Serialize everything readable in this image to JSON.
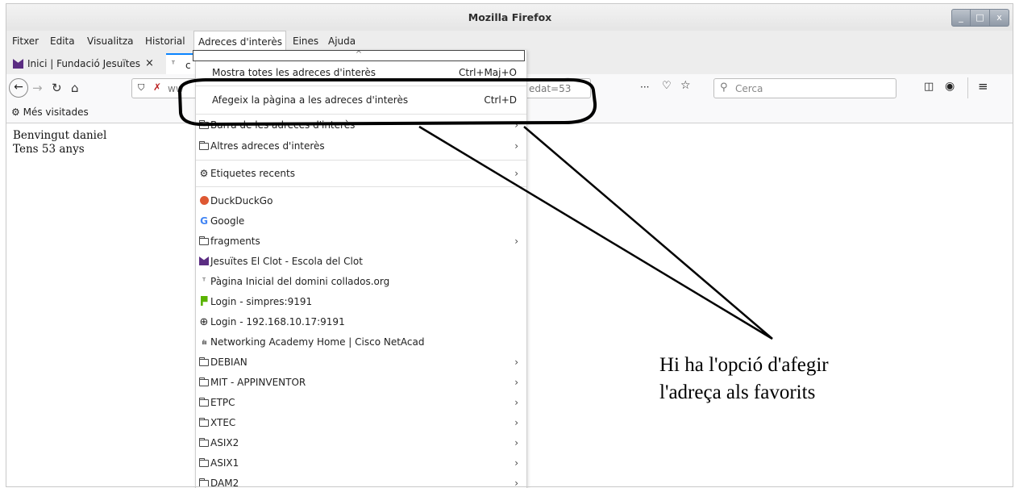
{
  "window": {
    "title": "Mozilla Firefox",
    "min": "_",
    "max": "□",
    "close": "x"
  },
  "menubar": {
    "items": [
      "Fitxer",
      "Edita",
      "Visualitza",
      "Historial",
      "Adreces d'interès",
      "Eines",
      "Ajuda"
    ]
  },
  "tabs": [
    {
      "label": "Inici | Fundació Jesuïtes",
      "close": "×"
    },
    {
      "label": "c"
    }
  ],
  "navbar": {
    "url_prefix": "ww",
    "url_suffix": "edat=53",
    "more": "···",
    "search_placeholder": "Cerca"
  },
  "bookmarks_toolbar": {
    "most_visited": "Més visitades"
  },
  "content": {
    "line1": "Benvingut daniel",
    "line2": "Tens 53 anys"
  },
  "bookmarks_menu": {
    "scroll_up": "^",
    "show_all": {
      "label": "Mostra totes les adreces d'interès",
      "shortcut": "Ctrl+Maj+O"
    },
    "add_page": {
      "label": "Afegeix la pàgina a les adreces d'interès",
      "shortcut": "Ctrl+D"
    },
    "toolbar_folder": "Barra de les adreces d'interès",
    "other_folder": "Altres adreces d'interès",
    "recent_tags": "Etiquetes recents",
    "entries": [
      {
        "label": "DuckDuckGo",
        "icon": "duckduckgo-icon",
        "submenu": false
      },
      {
        "label": "Google",
        "icon": "google-icon",
        "submenu": false
      },
      {
        "label": "fragments",
        "icon": "folder-icon",
        "submenu": true
      },
      {
        "label": "Jesuïtes El Clot - Escola del Clot",
        "icon": "jesuites-icon",
        "submenu": false
      },
      {
        "label": "Pàgina Inicial del domini collados.org",
        "icon": "collados-icon",
        "submenu": false
      },
      {
        "label": "Login - simpres:9191",
        "icon": "papercut-icon",
        "submenu": false
      },
      {
        "label": "Login - 192.168.10.17:9191",
        "icon": "globe-icon",
        "submenu": false
      },
      {
        "label": "Networking Academy Home | Cisco NetAcad",
        "icon": "cisco-icon",
        "submenu": false
      },
      {
        "label": "DEBIAN",
        "icon": "folder-icon",
        "submenu": true
      },
      {
        "label": "MIT - APPINVENTOR",
        "icon": "folder-icon",
        "submenu": true
      },
      {
        "label": "ETPC",
        "icon": "folder-icon",
        "submenu": true
      },
      {
        "label": "XTEC",
        "icon": "folder-icon",
        "submenu": true
      },
      {
        "label": "ASIX2",
        "icon": "folder-icon",
        "submenu": true
      },
      {
        "label": "ASIX1",
        "icon": "folder-icon",
        "submenu": true
      },
      {
        "label": "DAM2",
        "icon": "folder-icon",
        "submenu": true
      }
    ]
  },
  "annotation": {
    "line1": "Hi ha l'opció d'afegir",
    "line2": "l'adreça als favorits"
  },
  "colors": {
    "tab_accent": "#0a84ff",
    "jesuites_purple": "#5b2d82",
    "ddg_orange": "#de5833",
    "papercut_green": "#5ab300"
  }
}
